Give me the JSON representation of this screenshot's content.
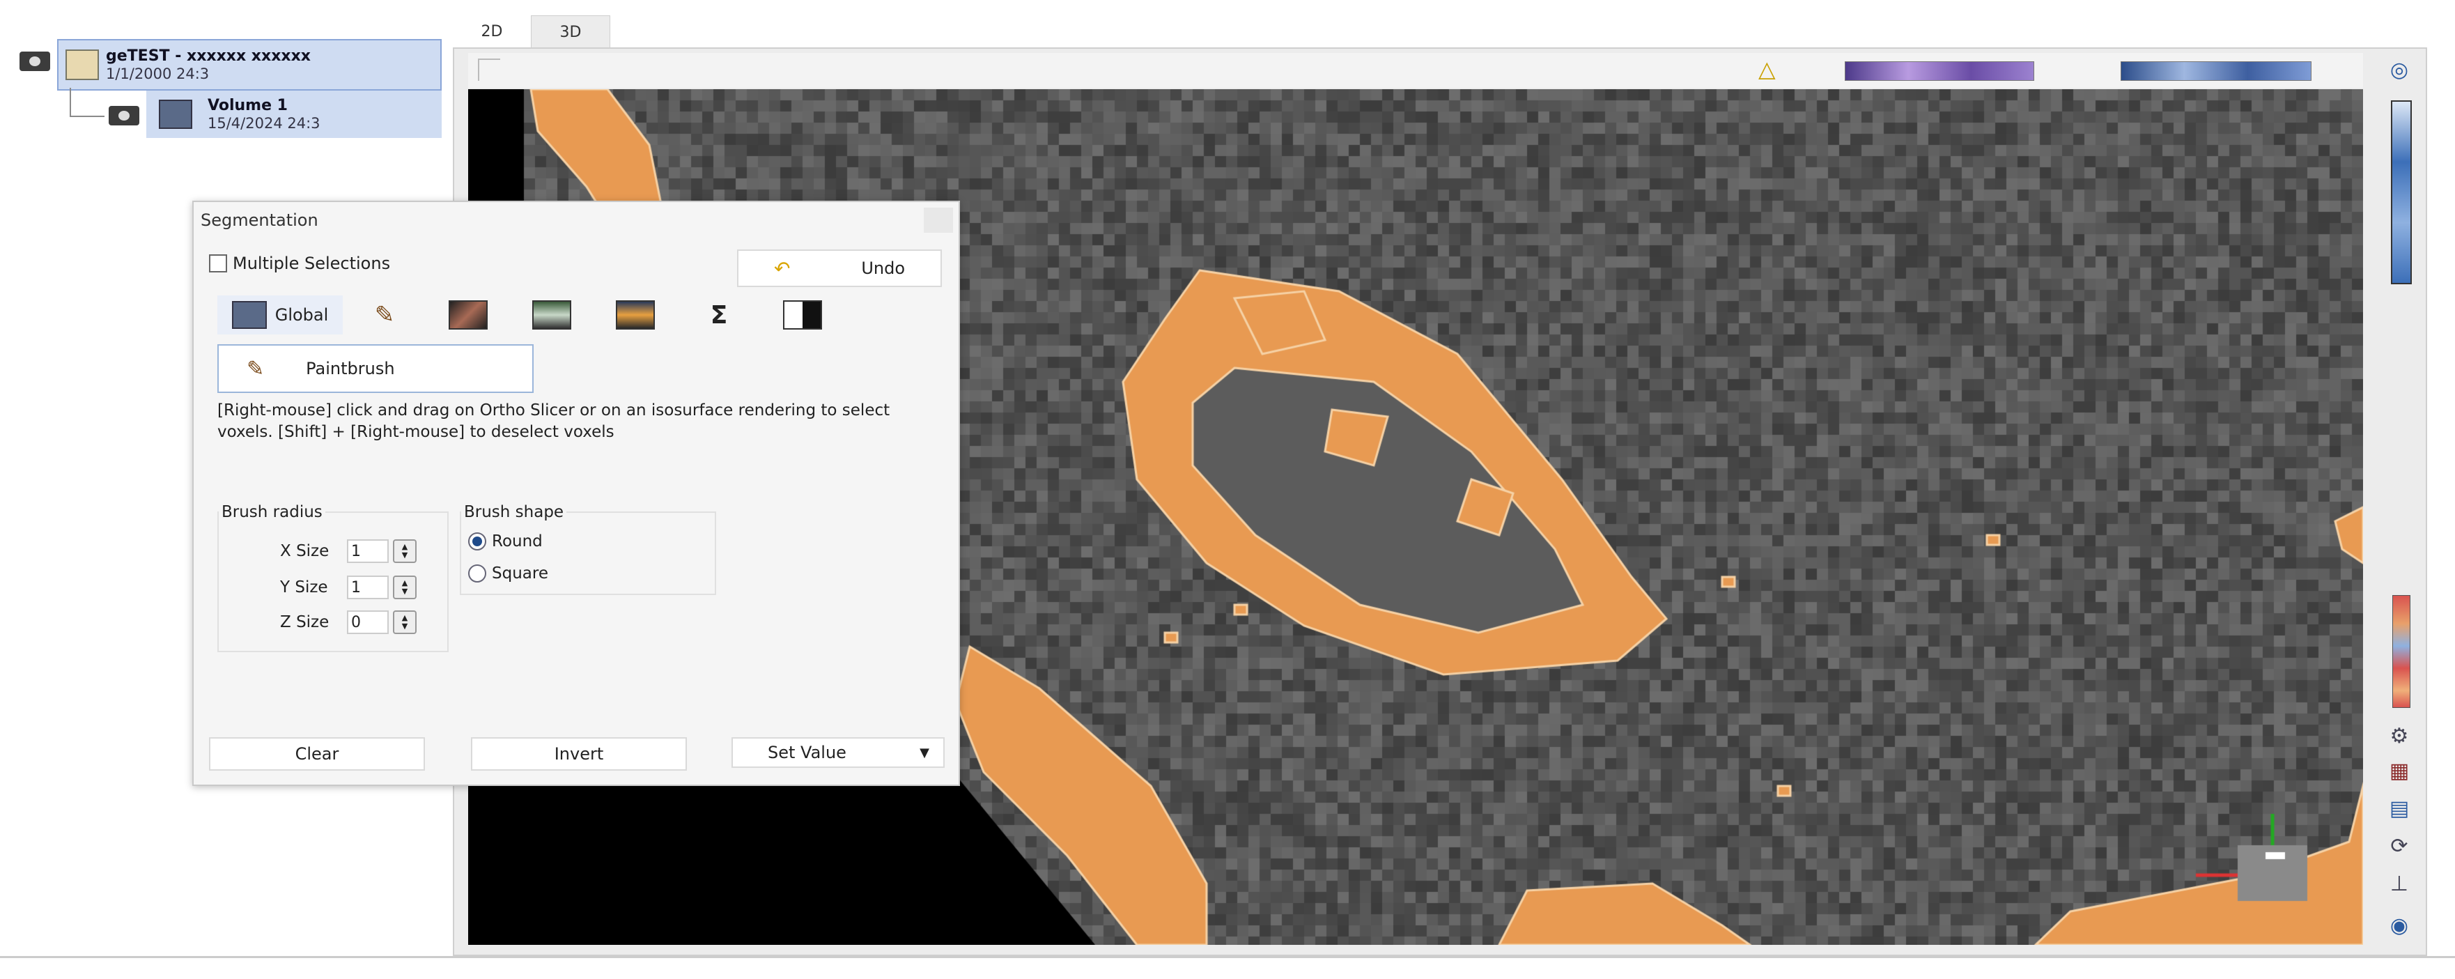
{
  "tree": {
    "study_title": "geTEST - xxxxxx xxxxxx",
    "study_date": "1/1/2000  24:3",
    "volume_title": "Volume 1",
    "volume_date": "15/4/2024  24:3"
  },
  "viewer": {
    "tabs": [
      "2D",
      "3D"
    ],
    "active_tab": "3D",
    "segmentation_color": "#e89a52",
    "colorbars": [
      "#8866bb",
      "#5578b0"
    ]
  },
  "segmentation": {
    "title": "Segmentation",
    "multiple_selections_label": "Multiple Selections",
    "multiple_selections_checked": false,
    "undo_label": "Undo",
    "tabs": [
      {
        "label": "Global",
        "icon": "global-icon"
      },
      {
        "label": "",
        "icon": "brush-icon"
      },
      {
        "label": "",
        "icon": "threshold-icon"
      },
      {
        "label": "",
        "icon": "region-grow-icon"
      },
      {
        "label": "",
        "icon": "histogram-icon"
      },
      {
        "label": "",
        "icon": "sigma-icon"
      },
      {
        "label": "",
        "icon": "mask-icon"
      }
    ],
    "mode_button": "Paintbrush",
    "description": "[Right-mouse] click and drag on Ortho Slicer or on an isosurface rendering to select voxels. [Shift] + [Right-mouse] to deselect voxels",
    "brush_radius": {
      "legend": "Brush radius",
      "x_label": "X Size",
      "x_value": "1",
      "y_label": "Y Size",
      "y_value": "1",
      "z_label": "Z Size",
      "z_value": "0"
    },
    "brush_shape": {
      "legend": "Brush shape",
      "options": [
        "Round",
        "Square"
      ],
      "selected": "Round"
    },
    "footer": {
      "clear": "Clear",
      "invert": "Invert",
      "set_value": "Set Value"
    }
  }
}
